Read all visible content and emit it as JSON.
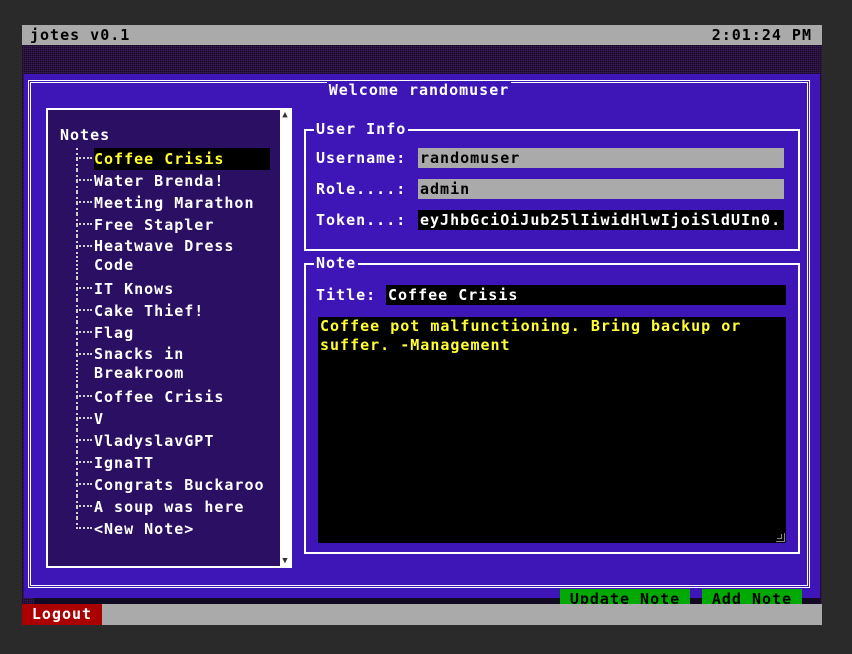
{
  "app": {
    "title": "jotes v0.1",
    "clock": "2:01:24 PM"
  },
  "dialog": {
    "title": "Welcome randomuser"
  },
  "notes": {
    "label": "Notes",
    "items": [
      {
        "label": "Coffee Crisis",
        "selected": true
      },
      {
        "label": "Water Brenda!"
      },
      {
        "label": "Meeting Marathon"
      },
      {
        "label": "Free Stapler"
      },
      {
        "label": "Heatwave Dress Code"
      },
      {
        "label": "IT Knows"
      },
      {
        "label": "Cake Thief!"
      },
      {
        "label": "Flag"
      },
      {
        "label": "Snacks in Breakroom"
      },
      {
        "label": "Coffee Crisis"
      },
      {
        "label": "V"
      },
      {
        "label": "VladyslavGPT"
      },
      {
        "label": "IgnaTT"
      },
      {
        "label": "Congrats Buckaroo"
      },
      {
        "label": "A soup was here"
      },
      {
        "label": "<New Note>"
      }
    ]
  },
  "user_info": {
    "title": "User Info",
    "username_label": "Username:",
    "username": "randomuser",
    "role_label": "Role....:",
    "role": "admin",
    "token_label": "Token...:",
    "token": "eyJhbGciOiJub25lIiwidHlwIjoiSldUIn0."
  },
  "note": {
    "title": "Note",
    "title_label": "Title:",
    "title_value": "Coffee Crisis",
    "body": "Coffee pot malfunctioning. Bring backup or suffer. -Management"
  },
  "buttons": {
    "update": "Update Note",
    "add": "Add Note",
    "logout": "Logout"
  },
  "colors": {
    "dialog_bg": "#3e16b8",
    "panel_bg": "#2a0f62",
    "selected_text": "#ffff33",
    "button": "#00aa00",
    "logout": "#aa0000",
    "bar": "#aaaaaa"
  }
}
